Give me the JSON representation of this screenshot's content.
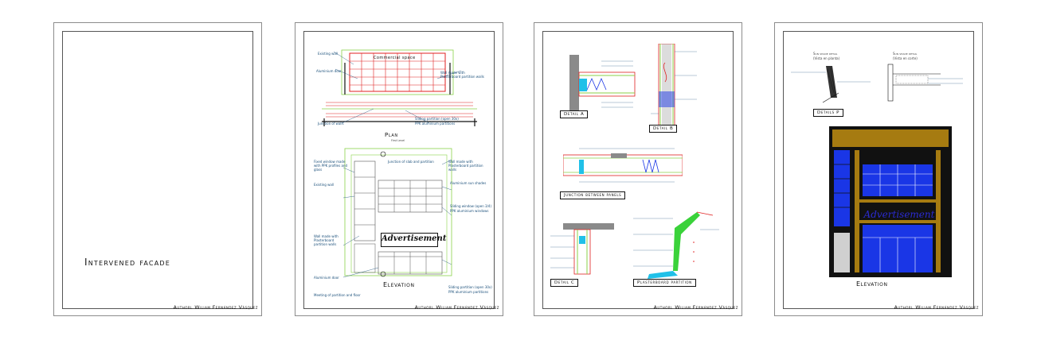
{
  "sheets": [
    {
      "title": "Intervened facade",
      "author": "Authorl Wiliam Fernández Vásquez"
    },
    {
      "author": "Authorl Wiliam Fernández Vásquez",
      "plan_title": "Plan",
      "plan_subtitle": "First Level",
      "plan_shop": "Commercial space",
      "elevation_title": "Elevation",
      "advert": "Advertisement",
      "labels": [
        "Existing wall",
        "Aluminium door",
        "Wall made with Plasterboard partition walls",
        "Junction of walls",
        "Sliding partition (open 30x)",
        "PPK aluminium partitions",
        "Fixed window made with PPK profiles and glass",
        "Junction of slab and partition",
        "Wall made with Plasterboard partition walls",
        "Existing wall",
        "Aluminium sun shades",
        "Sliding window (open 3/4)",
        "PPK aluminium windows",
        "Wall made with Plasterboard partition walls",
        "Aluminium door",
        "Sliding partition (open 30x)",
        "PPK aluminium partitions",
        "Meeting of partition and floor"
      ]
    },
    {
      "author": "Authorl Wiliam Fernández Vásquez",
      "details": [
        "Detail A",
        "Detail B",
        "Junction between panels",
        "Detail C",
        "Plasterboard partition"
      ]
    },
    {
      "author": "Authorl Wiliam Fernández Vásquez",
      "sun_shade_1": "Sun shade detail",
      "sun_shade_1_sub": "(Vista en planta)",
      "sun_shade_2": "Sun shade detail",
      "sun_shade_2_sub": "(Vista en corte)",
      "detail_p": "Details P",
      "advert": "Advertisement",
      "elevation_title": "Elevation"
    }
  ],
  "colors": {
    "sheet_border": "#8c8c8c",
    "frame": "#555555",
    "label_text": "#1a4f7a",
    "cad_red": "#e02020",
    "cad_green": "#8bd24a",
    "cad_blue": "#1a36e6",
    "facade_brown": "#a67b11",
    "facade_black": "#111111",
    "advert_blue": "#2b2bd1"
  }
}
